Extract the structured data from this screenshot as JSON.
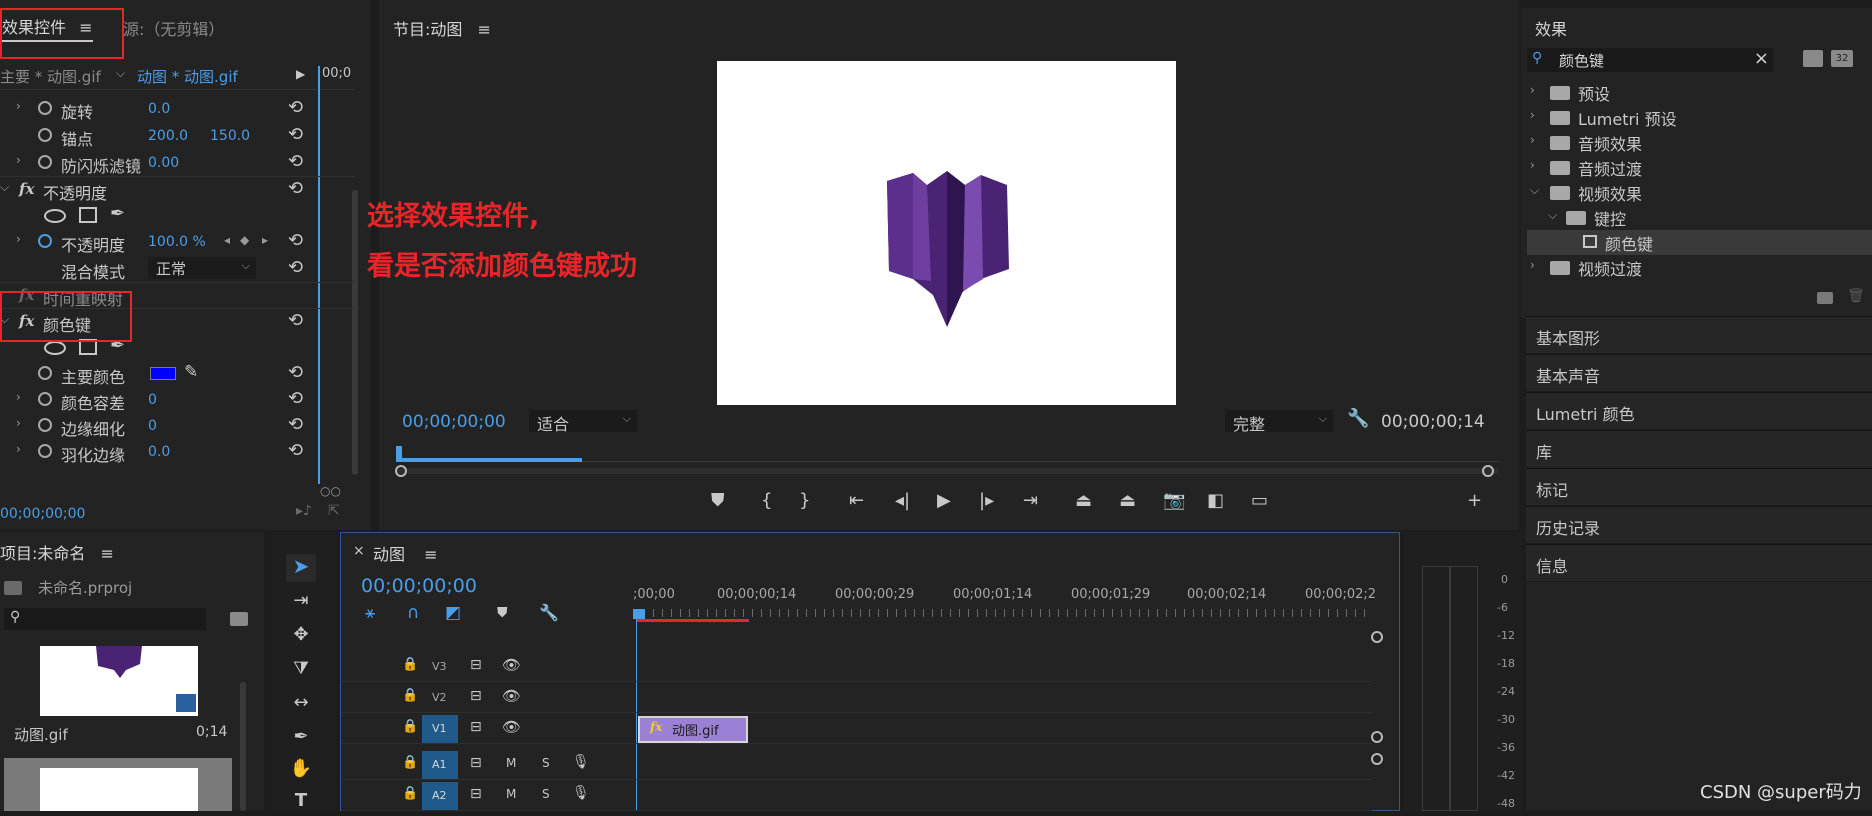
{
  "effect_controls": {
    "tab_title": "效果控件",
    "tab_menu": "≡",
    "source_tab": "源:（无剪辑）",
    "master_clip": "主要 * 动图.gif",
    "sequence_clip": "动图 * 动图.gif",
    "play_glyph": "▶",
    "ruler_time": "00;0",
    "rows": [
      {
        "label": "旋转",
        "value1": "0.0",
        "value2": ""
      },
      {
        "label": "锚点",
        "value1": "200.0",
        "value2": "150.0"
      },
      {
        "label": "防闪烁滤镜",
        "value1": "0.00",
        "value2": ""
      }
    ],
    "opacity_section": "不透明度",
    "opacity_label": "不透明度",
    "opacity_value": "100.0 %",
    "blend_label": "混合模式",
    "blend_value": "正常",
    "time_remap": "时间重映射",
    "color_key_section": "颜色键",
    "key_color_label": "主要颜色",
    "key_color": "#0000ff",
    "key_rows": [
      {
        "label": "颜色容差",
        "value": "0"
      },
      {
        "label": "边缘细化",
        "value": "0"
      },
      {
        "label": "羽化边缘",
        "value": "0.0"
      }
    ],
    "footer_time": "00;00;00;00",
    "fx_label": "fx",
    "reset_glyph": "⟲"
  },
  "program_monitor": {
    "title": "节目:动图",
    "menu": "≡",
    "timecode_left": "00;00;00;00",
    "fit_dropdown": "适合",
    "quality_dropdown": "完整",
    "timecode_right": "00;00;00;14",
    "wrench_icon": "wrench-icon"
  },
  "annotation": {
    "line1": "选择效果控件,",
    "line2": "看是否添加颜色键成功"
  },
  "effects_panel": {
    "title": "效果",
    "search_value": "颜色键",
    "items": [
      {
        "label": "预设",
        "level": 0,
        "expanded": false
      },
      {
        "label": "Lumetri 预设",
        "level": 0,
        "expanded": false
      },
      {
        "label": "音频效果",
        "level": 0,
        "expanded": false
      },
      {
        "label": "音频过渡",
        "level": 0,
        "expanded": false
      },
      {
        "label": "视频效果",
        "level": 0,
        "expanded": true
      },
      {
        "label": "键控",
        "level": 1,
        "expanded": true
      },
      {
        "label": "颜色键",
        "level": 2,
        "expanded": false
      },
      {
        "label": "视频过渡",
        "level": 0,
        "expanded": false
      }
    ],
    "sections": [
      "基本图形",
      "基本声音",
      "Lumetri 颜色",
      "库",
      "标记",
      "历史记录",
      "信息"
    ]
  },
  "project_panel": {
    "title": "项目:未命名",
    "menu": "≡",
    "file": "未命名.prproj",
    "clip_name": "动图.gif",
    "clip_duration": "0;14"
  },
  "timeline": {
    "close": "×",
    "title": "动图",
    "menu": "≡",
    "timecode": "00;00;00;00",
    "ruler_labels": [
      ";00;00",
      "00;00;00;14",
      "00;00;00;29",
      "00;00;01;14",
      "00;00;01;29",
      "00;00;02;14",
      "00;00;02;2"
    ],
    "tracks": [
      "V3",
      "V2",
      "V1",
      "A1",
      "A2"
    ],
    "clip_label": "动图.gif",
    "mute": "M",
    "solo": "S"
  },
  "meter_scale": [
    "0",
    "-6",
    "-12",
    "-18",
    "-24",
    "-30",
    "-36",
    "-42",
    "-48"
  ],
  "watermark": "CSDN @super码力",
  "colors": {
    "accent": "#4a9ee8",
    "annotation_red": "#e8262a",
    "clip_purple": "#9a81d6",
    "track_blue": "#1f5a8a"
  }
}
